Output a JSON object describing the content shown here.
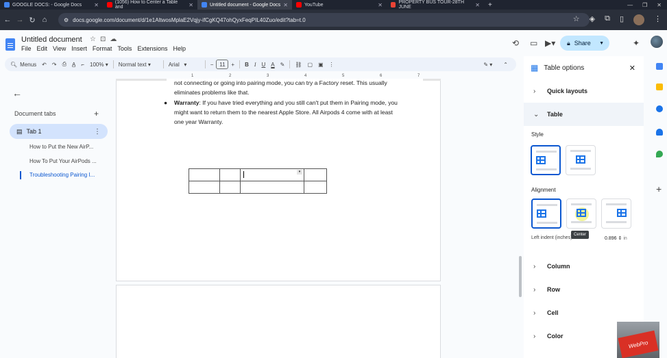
{
  "browser": {
    "tabs": [
      {
        "label": "GOOGLE DOCS: - Google Docs",
        "favicon_color": "#4285f4"
      },
      {
        "label": "(1056) How to Center a Table and",
        "favicon_color": "#ff0000"
      },
      {
        "label": "Untitled document - Google Docs",
        "favicon_color": "#4285f4"
      },
      {
        "label": "YouTube",
        "favicon_color": "#ff0000"
      },
      {
        "label": "PROPERTY BUS TOUR-28TH JUNE",
        "favicon_color": "#ea4335"
      }
    ],
    "url": "docs.google.com/document/d/1e1AltwosMplaE2Vqjy-ifCgKQ47ohQyxFeqPIL40Zuo/edit?tab=t.0"
  },
  "docs": {
    "title": "Untitled document",
    "menu": [
      "File",
      "Edit",
      "View",
      "Insert",
      "Format",
      "Tools",
      "Extensions",
      "Help"
    ],
    "share_label": "Share"
  },
  "toolbar": {
    "menus_label": "Menus",
    "zoom": "100%",
    "style": "Normal text",
    "font": "Arial",
    "font_size": "11"
  },
  "ruler": {
    "ticks": [
      "1",
      "2",
      "3",
      "4",
      "5",
      "6",
      "7"
    ]
  },
  "left_sidebar": {
    "heading": "Document tabs",
    "tab_name": "Tab 1",
    "outline": [
      "How to Put the New AirP...",
      "How To Put Your AirPods ...",
      "Troubleshooting Pairing I..."
    ]
  },
  "document": {
    "line1": "not connecting or going into pairing mode, you can try a Factory reset. This usually",
    "line2": "eliminates problems like that.",
    "bold_word": "Warranty",
    "bullet_text": ": If you have tried everything and you still can't put them in Pairing mode, you",
    "line4": "might want to return them to the nearest Apple Store. All Airpods 4 come with at least",
    "line5": "one year Warranty."
  },
  "panel": {
    "title": "Table options",
    "sections": {
      "quick_layouts": "Quick layouts",
      "table": "Table",
      "column": "Column",
      "row": "Row",
      "cell": "Cell",
      "color": "Color"
    },
    "style_label": "Style",
    "alignment_label": "Alignment",
    "tooltip": "Center",
    "indent_label": "Left indent (inches)",
    "indent_value": "0.896",
    "indent_unit": "in"
  },
  "overlay": {
    "logo_text": "WebPro"
  },
  "colors": {
    "accent": "#0b57d0",
    "share_bg": "#c2e7ff",
    "selected_tab_bg": "#d3e3fd"
  }
}
